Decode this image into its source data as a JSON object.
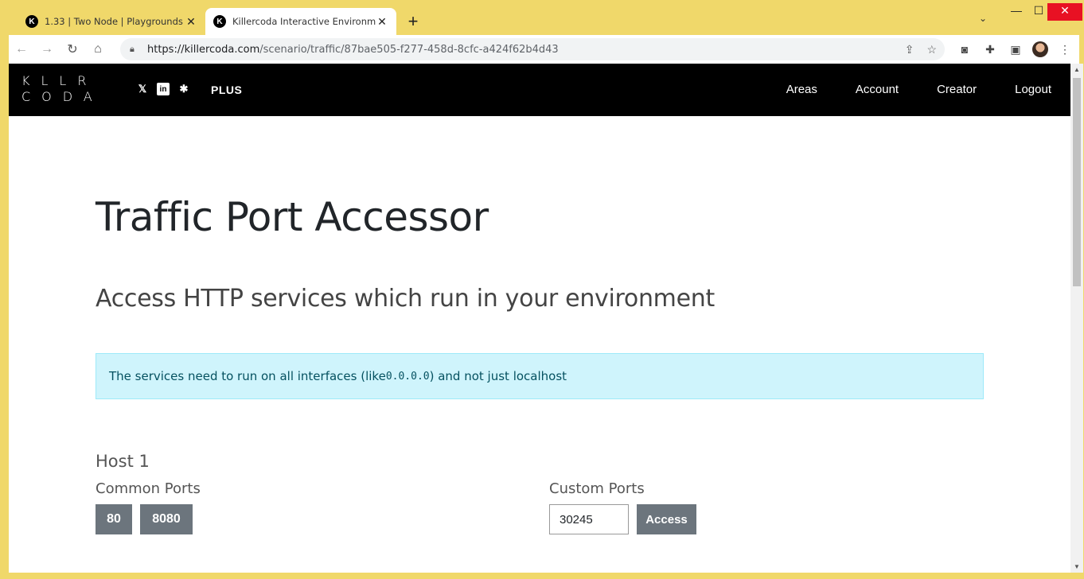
{
  "browser": {
    "tabs": [
      {
        "title": "1.33 | Two Node | Playgrounds | K",
        "favicon": "K",
        "active": false
      },
      {
        "title": "Killercoda Interactive Environmen",
        "favicon": "K",
        "active": true
      }
    ],
    "new_tab_label": "+",
    "url_host": "https://killercoda.com",
    "url_path": "/scenario/traffic/87bae505-f277-458d-8cfc-a424f62b4d43"
  },
  "site": {
    "logo_line1": "KLLR",
    "logo_line2": "CODA",
    "plus_label": "PLUS",
    "nav": [
      "Areas",
      "Account",
      "Creator",
      "Logout"
    ]
  },
  "page": {
    "title": "Traffic Port Accessor",
    "subtitle": "Access HTTP services which run in your environment",
    "alert_prefix": "The services need to run on all interfaces (like ",
    "alert_code": "0.0.0.0",
    "alert_suffix": ") and not just localhost",
    "host_title": "Host 1",
    "common_ports_label": "Common Ports",
    "common_ports": [
      "80",
      "8080"
    ],
    "custom_ports_label": "Custom Ports",
    "custom_port_value": "30245",
    "access_label": "Access"
  },
  "colors": {
    "titlebar": "#f0d86a",
    "navbar": "#000000",
    "alert_bg": "#cff4fc",
    "button": "#6c757d"
  }
}
